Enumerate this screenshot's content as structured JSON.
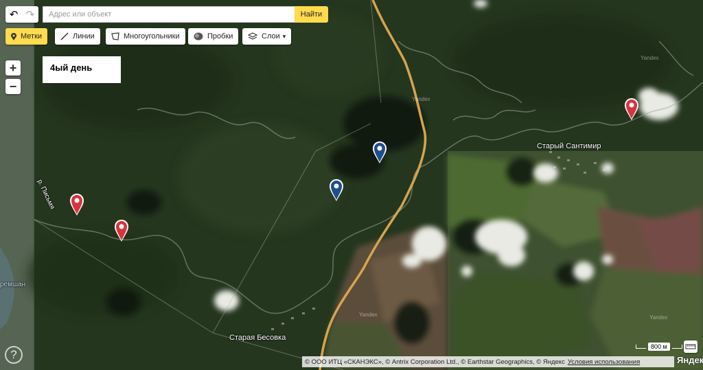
{
  "toolbar": {
    "search_placeholder": "Адрес или объект",
    "find_label": "Найти",
    "marks_label": "Метки",
    "lines_label": "Линии",
    "polygons_label": "Многоугольники",
    "traffic_label": "Пробки",
    "layers_label": "Слои"
  },
  "zoom": {
    "in_label": "+",
    "out_label": "−"
  },
  "infobox": {
    "title": "4ый день"
  },
  "map_labels": {
    "stary_santimir": "Старый Сантимир",
    "staraya_besovka": "Старая Бесовка",
    "river_pismyanka": "р. Письмя",
    "river_cheremshan": "ремшан"
  },
  "watermark": "Yandex",
  "scale": {
    "label": "800 м"
  },
  "copyright": {
    "text": "© ООО ИТЦ «СКАНЭКС», © Antrix Corporation Ltd., © Earthstar Geographics, © Яндекс",
    "terms_label": "Условия использования"
  },
  "logo": "Яндекс",
  "help_label": "?",
  "markers": [
    {
      "name": "red-marker-1",
      "color": "#d9333f"
    },
    {
      "name": "red-marker-2",
      "color": "#d9333f"
    },
    {
      "name": "red-marker-3",
      "color": "#d9333f"
    },
    {
      "name": "blue-marker-1",
      "color": "#1e4f8c"
    },
    {
      "name": "blue-marker-2",
      "color": "#1e4f8c"
    }
  ],
  "colors": {
    "accent": "#ffdb4d",
    "road": "#e0a94a"
  }
}
